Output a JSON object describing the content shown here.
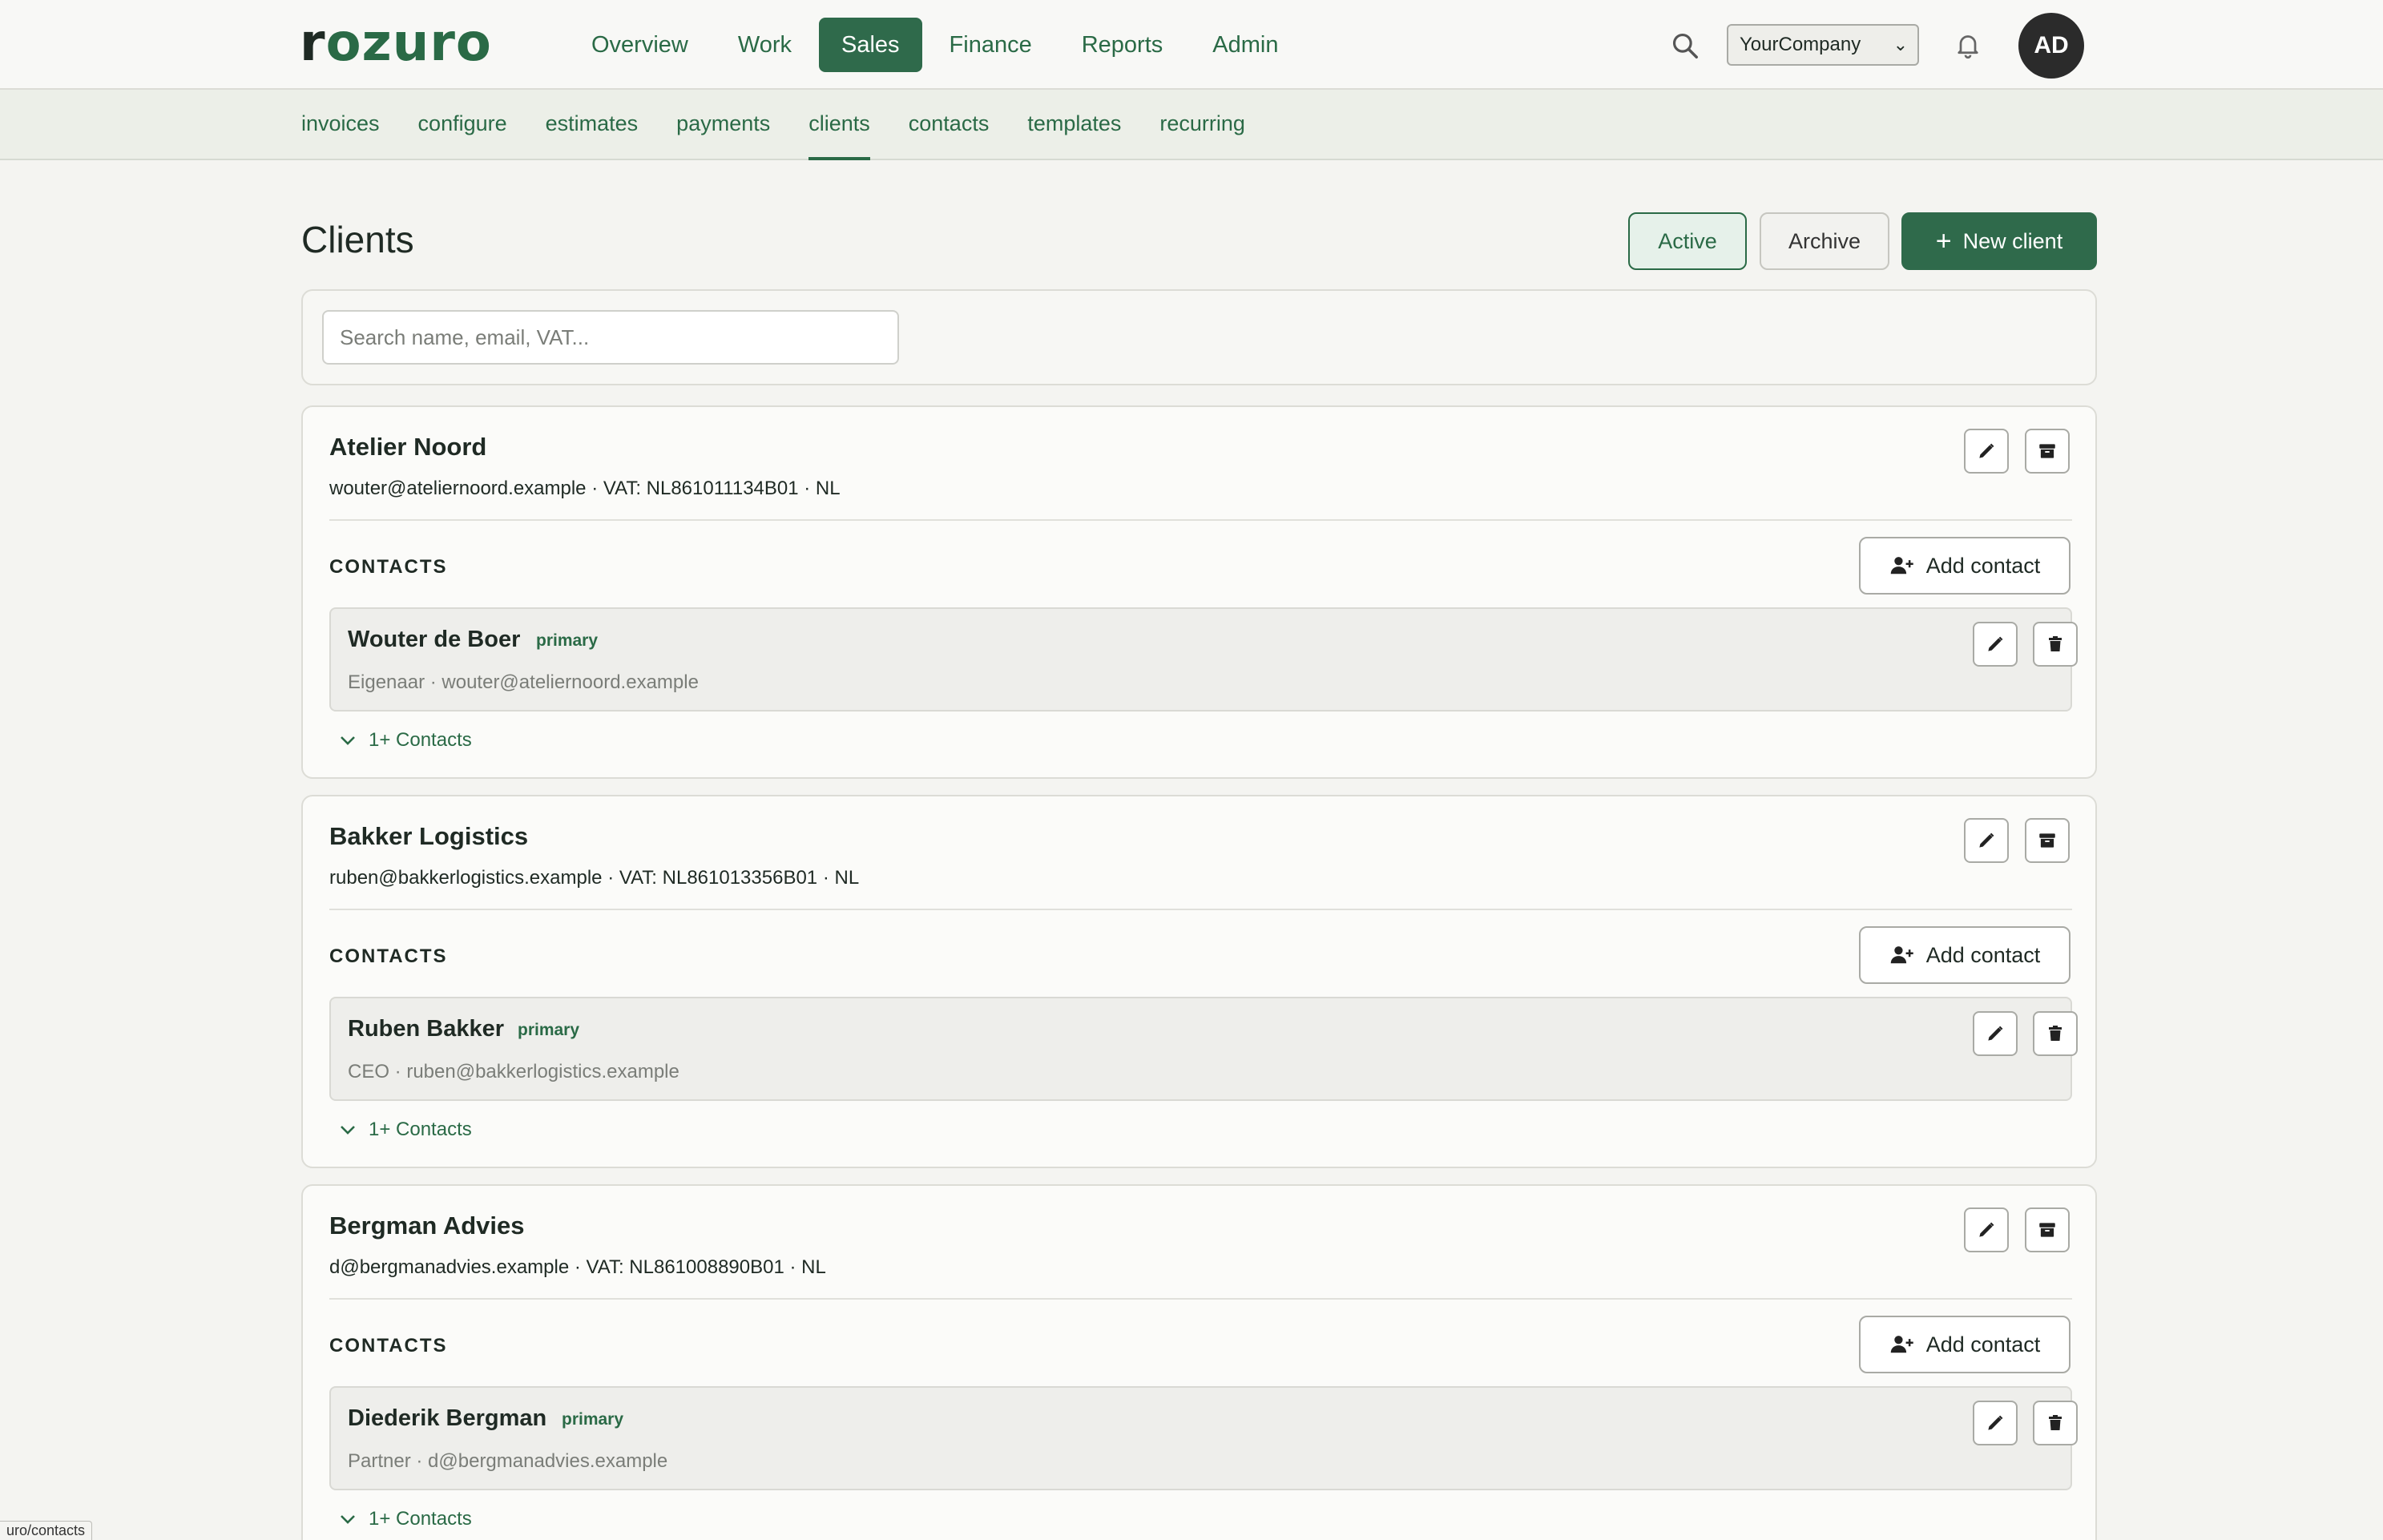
{
  "app": {
    "logo": "rozuro",
    "main_nav": [
      "Overview",
      "Work",
      "Sales",
      "Finance",
      "Reports",
      "Admin"
    ],
    "main_nav_active": "Sales",
    "company": "YourCompany",
    "user_initials": "AD"
  },
  "sub_nav": {
    "items": [
      "invoices",
      "configure",
      "estimates",
      "payments",
      "clients",
      "contacts",
      "templates",
      "recurring"
    ],
    "active": "clients"
  },
  "page": {
    "title": "Clients",
    "filter_active_label": "Active",
    "filter_archive_label": "Archive",
    "new_client_label": "New client",
    "search_placeholder": "Search name, email, VAT..."
  },
  "clients": [
    {
      "name": "Atelier Noord",
      "meta": "wouter@ateliernoord.example · VAT: NL861011134B01 · NL",
      "contacts_label": "CONTACTS",
      "add_contact_label": "Add contact",
      "contact": {
        "name": "Wouter de Boer",
        "badge": "primary",
        "meta": "Eigenaar · wouter@ateliernoord.example"
      },
      "more_label": "1+ Contacts"
    },
    {
      "name": "Bakker Logistics",
      "meta": "ruben@bakkerlogistics.example · VAT: NL861013356B01 · NL",
      "contacts_label": "CONTACTS",
      "add_contact_label": "Add contact",
      "contact": {
        "name": "Ruben Bakker",
        "badge": "primary",
        "meta": "CEO · ruben@bakkerlogistics.example"
      },
      "more_label": "1+ Contacts"
    },
    {
      "name": "Bergman Advies",
      "meta": "d@bergmanadvies.example · VAT: NL861008890B01 · NL",
      "contacts_label": "CONTACTS",
      "add_contact_label": "Add contact",
      "contact": {
        "name": "Diederik Bergman",
        "badge": "primary",
        "meta": "Partner · d@bergmanadvies.example"
      },
      "more_label": "1+ Contacts"
    }
  ],
  "status_url": "uro/contacts",
  "colors": {
    "brand": "#2f6a4b",
    "accent_text": "#2a6a46",
    "page_bg": "#f4f4f1"
  }
}
